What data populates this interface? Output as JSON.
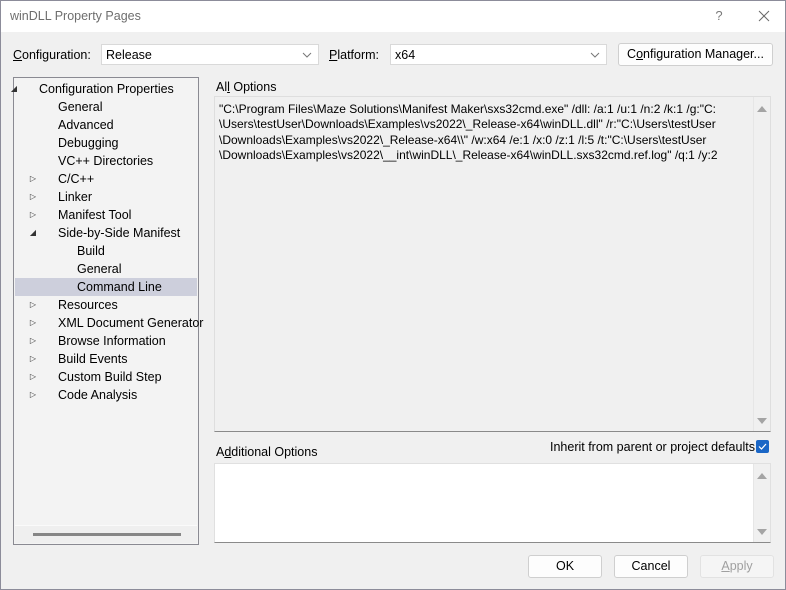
{
  "window": {
    "title": "winDLL Property Pages",
    "help_label": "?",
    "close_label": "close"
  },
  "toolbar": {
    "configuration_label_prefix": "C",
    "configuration_label_rest": "onfiguration:",
    "configuration_value": "Release",
    "platform_label_prefix": "P",
    "platform_label_rest": "latform:",
    "platform_value": "x64",
    "config_manager_prefix": "C",
    "config_manager_u": "o",
    "config_manager_rest": "nfiguration Manager..."
  },
  "tree": {
    "items": [
      {
        "label": "Configuration Properties",
        "level": 0,
        "toggle": "expanded",
        "selected": false
      },
      {
        "label": "General",
        "level": 1,
        "toggle": "none",
        "selected": false
      },
      {
        "label": "Advanced",
        "level": 1,
        "toggle": "none",
        "selected": false
      },
      {
        "label": "Debugging",
        "level": 1,
        "toggle": "none",
        "selected": false
      },
      {
        "label": "VC++ Directories",
        "level": 1,
        "toggle": "none",
        "selected": false
      },
      {
        "label": "C/C++",
        "level": 1,
        "toggle": "collapsed",
        "selected": false
      },
      {
        "label": "Linker",
        "level": 1,
        "toggle": "collapsed",
        "selected": false
      },
      {
        "label": "Manifest Tool",
        "level": 1,
        "toggle": "collapsed",
        "selected": false
      },
      {
        "label": "Side-by-Side Manifest",
        "level": 1,
        "toggle": "expanded",
        "selected": false
      },
      {
        "label": "Build",
        "level": 2,
        "toggle": "none",
        "selected": false
      },
      {
        "label": "General",
        "level": 2,
        "toggle": "none",
        "selected": false
      },
      {
        "label": "Command Line",
        "level": 2,
        "toggle": "none",
        "selected": true
      },
      {
        "label": "Resources",
        "level": 1,
        "toggle": "collapsed",
        "selected": false
      },
      {
        "label": "XML Document Generator",
        "level": 1,
        "toggle": "collapsed",
        "selected": false
      },
      {
        "label": "Browse Information",
        "level": 1,
        "toggle": "collapsed",
        "selected": false
      },
      {
        "label": "Build Events",
        "level": 1,
        "toggle": "collapsed",
        "selected": false
      },
      {
        "label": "Custom Build Step",
        "level": 1,
        "toggle": "collapsed",
        "selected": false
      },
      {
        "label": "Code Analysis",
        "level": 1,
        "toggle": "collapsed",
        "selected": false
      }
    ]
  },
  "all_options": {
    "label_pre": "Al",
    "label_u": "l",
    "label_post": " Options",
    "lines": [
      "\"C:\\Program Files\\Maze Solutions\\Manifest Maker\\sxs32cmd.exe\" /dll: /a:1 /u:1 /n:2 /k:1 /g:\"C:",
      "\\Users\\testUser\\Downloads\\Examples\\vs2022\\_Release-x64\\winDLL.dll\" /r:\"C:\\Users\\testUser",
      "\\Downloads\\Examples\\vs2022\\_Release-x64\\\\\" /w:x64 /e:1 /x:0 /z:1 /l:5 /t:\"C:\\Users\\testUser",
      "\\Downloads\\Examples\\vs2022\\__int\\winDLL\\_Release-x64\\winDLL.sxs32cmd.ref.log\" /q:1 /y:2"
    ]
  },
  "additional_options": {
    "label_pre": "A",
    "label_u": "d",
    "label_post": "ditional Options",
    "value": ""
  },
  "inherit": {
    "label": "Inherit from parent or project defaults",
    "checked": true
  },
  "buttons": {
    "ok": "OK",
    "cancel": "Cancel",
    "apply_u": "A",
    "apply_rest": "pply"
  },
  "colors": {
    "selection": "#cdcfdc",
    "checkbox_accent": "#1a66c6"
  }
}
